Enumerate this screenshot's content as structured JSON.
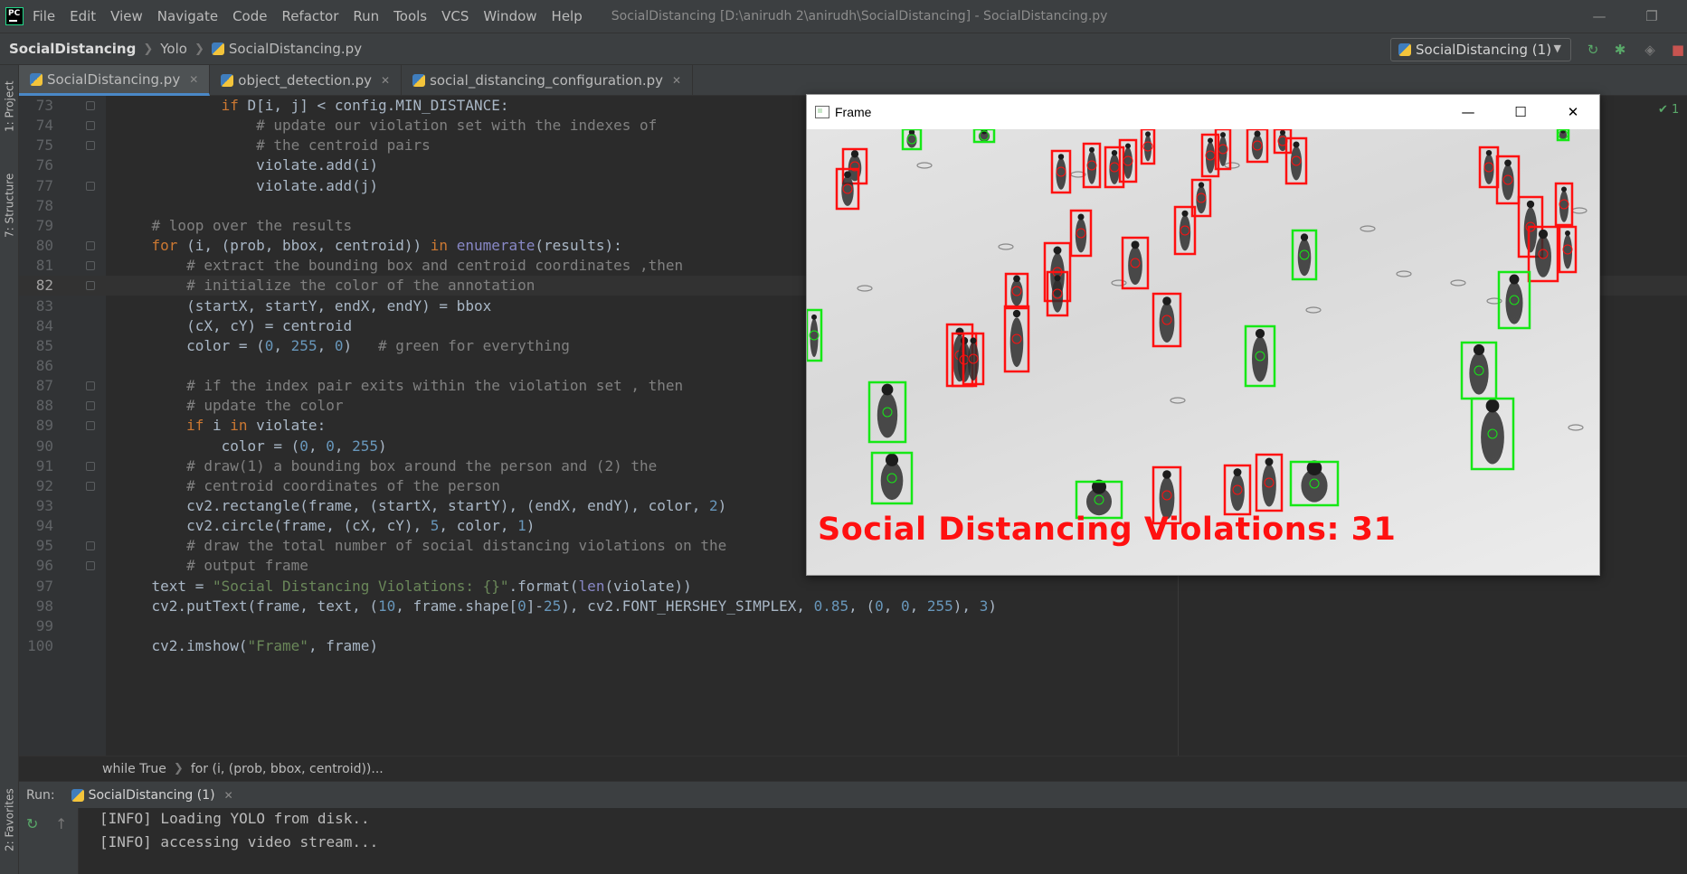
{
  "menubar": {
    "items": [
      "File",
      "Edit",
      "View",
      "Navigate",
      "Code",
      "Refactor",
      "Run",
      "Tools",
      "VCS",
      "Window",
      "Help"
    ],
    "title": "SocialDistancing [D:\\anirudh 2\\anirudh\\SocialDistancing] - SocialDistancing.py",
    "logo_text": "PC"
  },
  "navbar": {
    "project": "SocialDistancing",
    "folder": "Yolo",
    "file": "SocialDistancing.py",
    "run_config": "SocialDistancing (1)"
  },
  "left_strip": {
    "project_tab": "1: Project",
    "structure_tab": "7: Structure",
    "favorites_tab": "2: Favorites"
  },
  "tabs": [
    {
      "label": "SocialDistancing.py"
    },
    {
      "label": "object_detection.py"
    },
    {
      "label": "social_distancing_configuration.py"
    }
  ],
  "editor": {
    "current_line": "82",
    "inspection_count": "1",
    "lines": [
      {
        "n": "73",
        "text": "            if D[i, j] < config.MIN_DISTANCE:"
      },
      {
        "n": "74",
        "text": "                # update our violation set with the indexes of"
      },
      {
        "n": "75",
        "text": "                # the centroid pairs"
      },
      {
        "n": "76",
        "text": "                violate.add(i)"
      },
      {
        "n": "77",
        "text": "                violate.add(j)"
      },
      {
        "n": "78",
        "text": ""
      },
      {
        "n": "79",
        "text": "    # loop over the results"
      },
      {
        "n": "80",
        "text": "    for (i, (prob, bbox, centroid)) in enumerate(results):"
      },
      {
        "n": "81",
        "text": "        # extract the bounding box and centroid coordinates ,then"
      },
      {
        "n": "82",
        "text": "        # initialize the color of the annotation"
      },
      {
        "n": "83",
        "text": "        (startX, startY, endX, endY) = bbox"
      },
      {
        "n": "84",
        "text": "        (cX, cY) = centroid"
      },
      {
        "n": "85",
        "text": "        color = (0, 255, 0)   # green for everything"
      },
      {
        "n": "86",
        "text": ""
      },
      {
        "n": "87",
        "text": "        # if the index pair exits within the violation set , then"
      },
      {
        "n": "88",
        "text": "        # update the color"
      },
      {
        "n": "89",
        "text": "        if i in violate:"
      },
      {
        "n": "90",
        "text": "            color = (0, 0, 255)"
      },
      {
        "n": "91",
        "text": "        # draw(1) a bounding box around the person and (2) the"
      },
      {
        "n": "92",
        "text": "        # centroid coordinates of the person"
      },
      {
        "n": "93",
        "text": "        cv2.rectangle(frame, (startX, startY), (endX, endY), color, 2)"
      },
      {
        "n": "94",
        "text": "        cv2.circle(frame, (cX, cY), 5, color, 1)"
      },
      {
        "n": "95",
        "text": "        # draw the total number of social distancing violations on the"
      },
      {
        "n": "96",
        "text": "        # output frame"
      },
      {
        "n": "97",
        "text": "    text = \"Social Distancing Violations: {}\".format(len(violate))"
      },
      {
        "n": "98",
        "text": "    cv2.putText(frame, text, (10, frame.shape[0]-25), cv2.FONT_HERSHEY_SIMPLEX, 0.85, (0, 0, 255), 3)"
      },
      {
        "n": "99",
        "text": ""
      },
      {
        "n": "100",
        "text": "    cv2.imshow(\"Frame\", frame)"
      }
    ]
  },
  "code_breadcrumb": {
    "first": "while True",
    "second": "for (i, (prob, bbox, centroid))..."
  },
  "run": {
    "label": "Run:",
    "tab": "SocialDistancing (1)",
    "console": [
      "[INFO] Loading YOLO from disk..",
      "[INFO] accessing video stream..."
    ]
  },
  "frame_window": {
    "title": "Frame",
    "overlay_text": "Social Distancing Violations: 31",
    "violation_color": "#ff1010",
    "safe_color": "#16e816"
  },
  "colors": {
    "editor_bg": "#2b2b2b",
    "keyword": "#cc7832",
    "comment": "#808080",
    "number": "#6897bb",
    "string": "#6a8759",
    "accent_tab": "#4a88c7"
  }
}
